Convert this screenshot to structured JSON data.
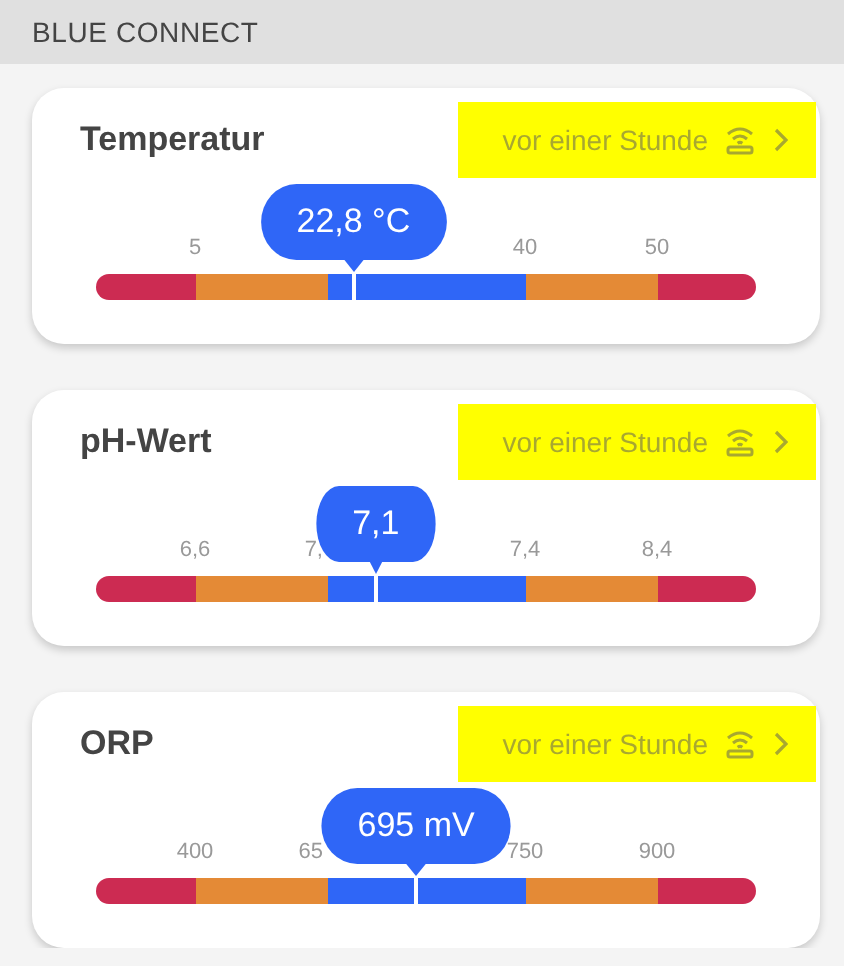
{
  "header": {
    "title": "BLUE CONNECT"
  },
  "cards": [
    {
      "title": "Temperatur",
      "updated": "vor einer Stunde",
      "reading": "22,8 °C",
      "level": 0.39,
      "ticks": [
        {
          "label": "5",
          "kind": "full"
        },
        {
          "label": "40",
          "kind": "full"
        },
        {
          "label": "50",
          "kind": "full"
        }
      ]
    },
    {
      "title": "pH-Wert",
      "updated": "vor einer Stunde",
      "reading": "7,1",
      "level": 0.424,
      "ticks": [
        {
          "label": "6,6",
          "kind": "full"
        },
        {
          "label": "7,",
          "kind": "cut"
        },
        {
          "label": "7,4",
          "kind": "full"
        },
        {
          "label": "8,4",
          "kind": "full"
        }
      ]
    },
    {
      "title": "ORP",
      "updated": "vor einer Stunde",
      "reading": "695 mV",
      "level": 0.485,
      "ticks": [
        {
          "label": "400",
          "kind": "full"
        },
        {
          "label": "65",
          "kind": "cut"
        },
        {
          "label": "750",
          "kind": "full"
        },
        {
          "label": "900",
          "kind": "full"
        }
      ]
    }
  ]
}
